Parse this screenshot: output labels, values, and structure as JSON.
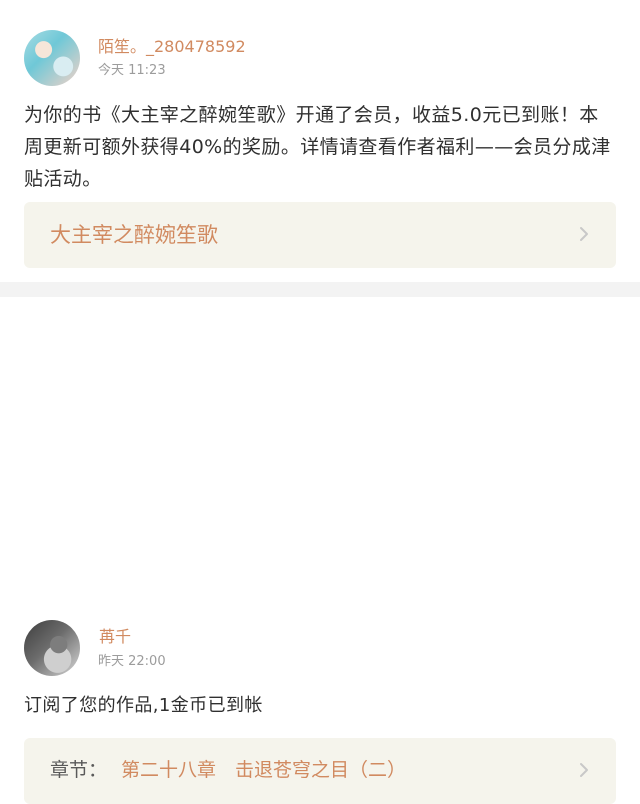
{
  "messages": [
    {
      "name": "陌笙。_280478592",
      "time": "今天 11:23",
      "body": "为你的书《大主宰之醉婉笙歌》开通了会员，收益5.0元已到账！本周更新可额外获得40%的奖励。详情请查看作者福利——会员分成津贴活动。",
      "link_title": "大主宰之醉婉笙歌"
    },
    {
      "name": "苒千",
      "time": "昨天 22:00",
      "body": "订阅了您的作品,1金币已到帐",
      "chapter_label": "章节：",
      "chapter_text": "第二十八章　击退苍穹之目（二）"
    }
  ],
  "icons": {
    "avatar_1": "avatar",
    "avatar_2": "avatar",
    "chevron_right": "chevron-right-icon"
  },
  "colors": {
    "accent": "#d18a60",
    "muted_text": "#9c9c9c",
    "body_text": "#303030",
    "link_bg": "#f5f4ec",
    "divider_bg": "#f3f3f3"
  }
}
